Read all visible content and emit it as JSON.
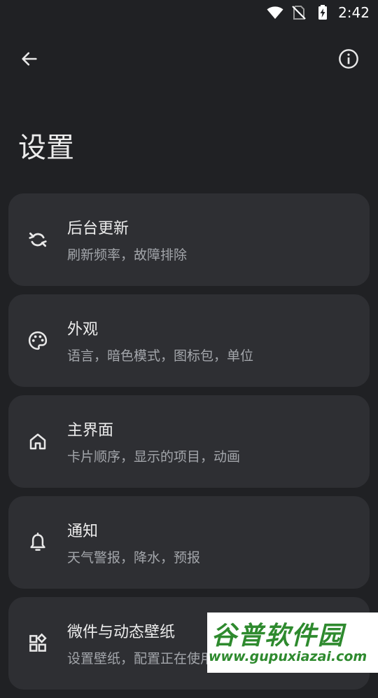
{
  "status_bar": {
    "time": "2:42",
    "icons": [
      "wifi-icon",
      "no-sim-icon",
      "battery-charging-icon"
    ]
  },
  "top_bar": {
    "back_icon": "arrow-left-icon",
    "info_icon": "info-circle-icon"
  },
  "page_title": "设置",
  "items": [
    {
      "icon": "sync-icon",
      "title": "后台更新",
      "subtitle": "刷新频率，故障排除"
    },
    {
      "icon": "palette-icon",
      "title": "外观",
      "subtitle": "语言，暗色模式，图标包，单位"
    },
    {
      "icon": "home-icon",
      "title": "主界面",
      "subtitle": "卡片顺序，显示的项目，动画"
    },
    {
      "icon": "bell-icon",
      "title": "通知",
      "subtitle": "天气警报，降水，预报"
    },
    {
      "icon": "widgets-icon",
      "title": "微件与动态壁纸",
      "subtitle": "设置壁纸，配置正在使用"
    }
  ],
  "watermark": {
    "line1": "谷普软件园",
    "line2": "www.gupuxiazai.com"
  },
  "colors": {
    "background": "#202124",
    "card": "#2e2f33",
    "text_primary": "#ececec",
    "text_secondary": "#a3a6ab",
    "watermark_green": "#2e8a2e"
  }
}
